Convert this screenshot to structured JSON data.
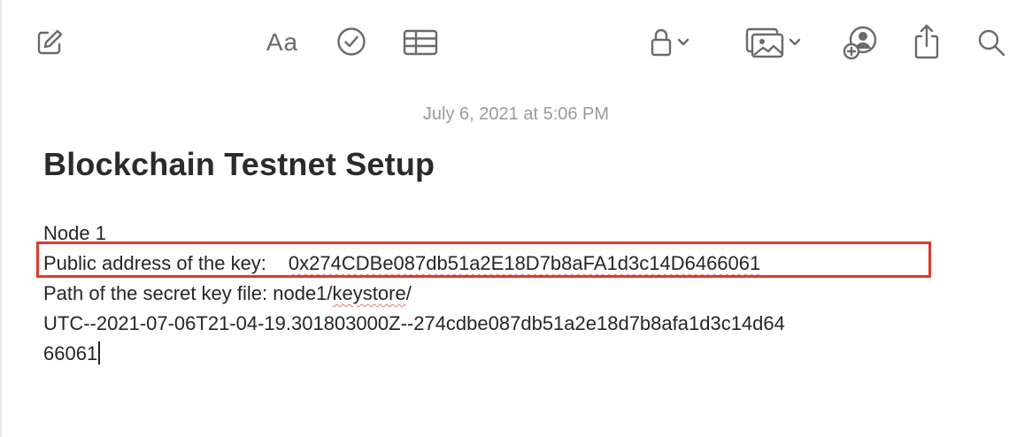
{
  "toolbar": {
    "compose_icon": "compose-icon",
    "format_label": "Aa",
    "checklist_icon": "checkmark-circle-icon",
    "table_icon": "table-icon",
    "lock_icon": "lock-icon",
    "media_icon": "photo-icon",
    "collab_icon": "add-person-icon",
    "share_icon": "share-icon",
    "search_icon": "search-icon"
  },
  "note": {
    "date": "July 6, 2021 at 5:06 PM",
    "title": "Blockchain Testnet Setup",
    "lines": {
      "node": "Node 1",
      "address_label": "Public address of the key:",
      "address_value": "0x274CDBe087db51a2E18D7b8aFA1d3c14D6466061",
      "path_label": "Path of the secret key file: node1/",
      "path_keystore": "keystore",
      "path_slash": "/",
      "path_line2": "UTC--2021-07-06T21-04-19.301803000Z--274cdbe087db51a2e18d7b8afa1d3c14d64",
      "path_line3": "66061"
    }
  },
  "colors": {
    "highlight_border": "#e0392b",
    "spellcheck_underline": "#e07a7a",
    "icon": "#6a6a6a"
  }
}
